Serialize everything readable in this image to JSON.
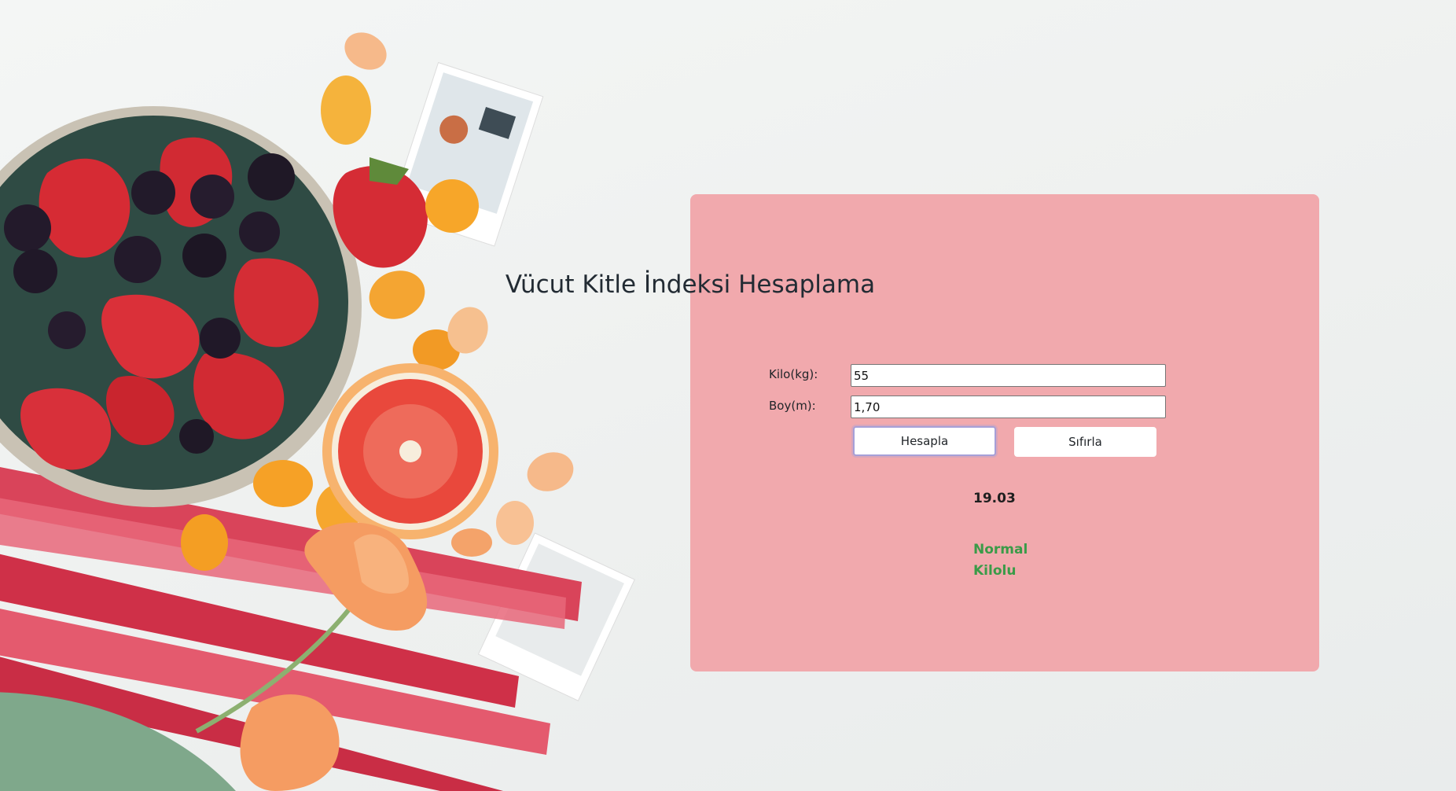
{
  "calculator": {
    "title": "Vücut Kitle İndeksi Hesaplama",
    "weight_label": "Kilo(kg):",
    "weight_value": "55",
    "height_label": "Boy(m):",
    "height_value": "1,70",
    "calculate_label": "Hesapla",
    "reset_label": "Sıfırla",
    "result_value": "19.03",
    "result_status": "Normal Kilolu"
  },
  "colors": {
    "card_background": "#f1a9ad",
    "status_color": "#3a9b48"
  }
}
